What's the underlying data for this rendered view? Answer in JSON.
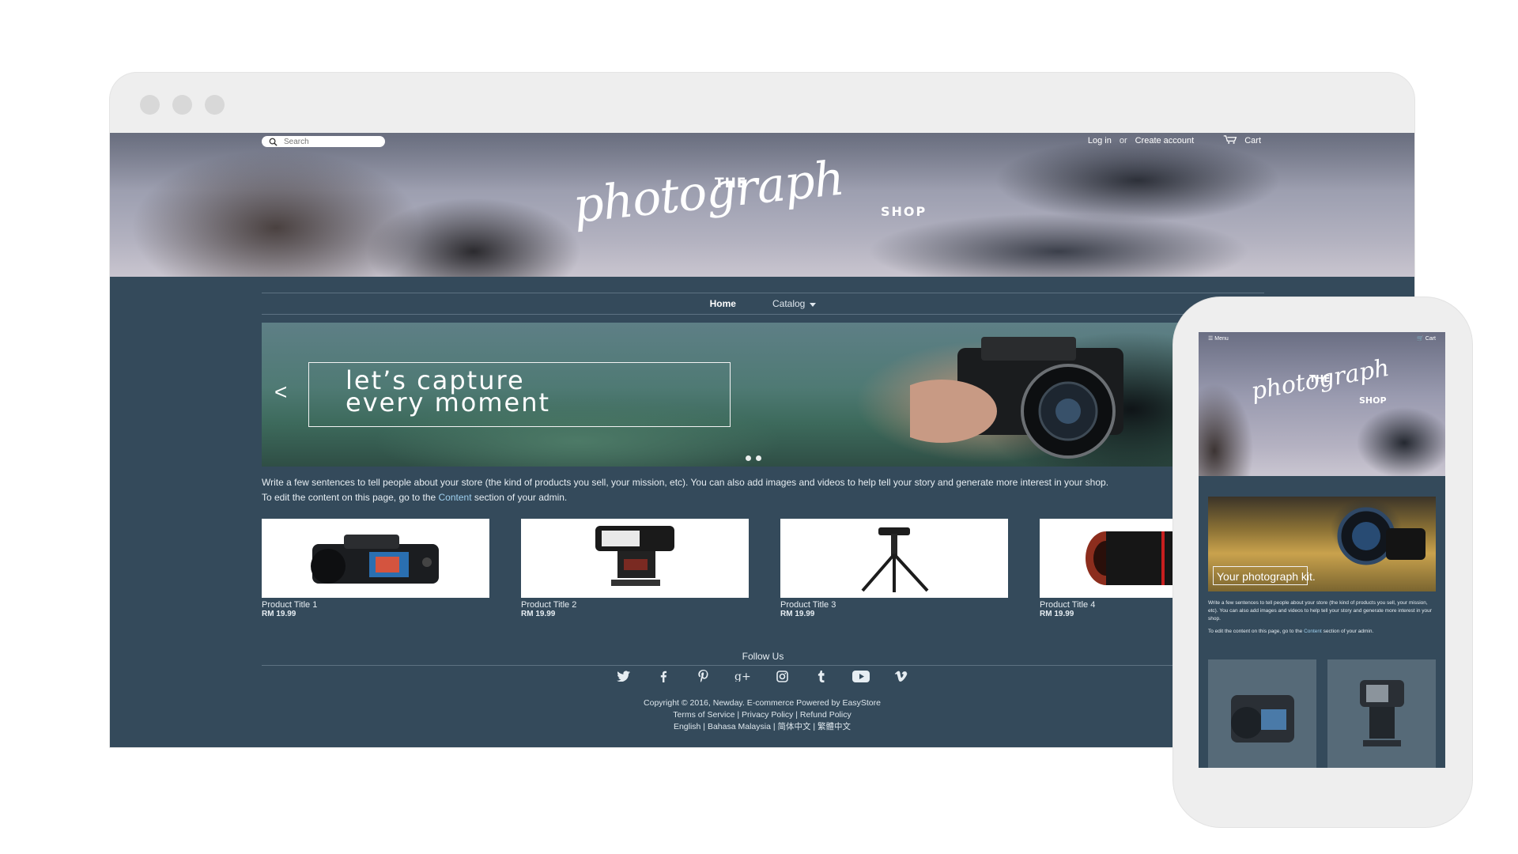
{
  "desktop": {
    "header": {
      "search_placeholder": "Search",
      "login_label": "Log in",
      "or_label": "or",
      "create_account_label": "Create account",
      "cart_label": "Cart",
      "logo": {
        "top": "THE",
        "script": "photograph",
        "bottom": "SHOP"
      }
    },
    "nav": {
      "home": "Home",
      "catalog": "Catalog"
    },
    "slideshow": {
      "line1": "let’s capture",
      "line2": "every moment",
      "prev_arrow": "<",
      "total_slides": 2
    },
    "intro": {
      "p1": "Write a few sentences to tell people about your store (the kind of products you sell, your mission, etc). You can also add images and videos to help tell your story and generate more interest in your shop.",
      "p2_prefix": "To edit the content on this page, go to the ",
      "p2_link": "Content",
      "p2_suffix": " section of your admin."
    },
    "products": [
      {
        "title": "Product Title 1",
        "price": "RM 19.99",
        "icon": "dslr-camera"
      },
      {
        "title": "Product Title 2",
        "price": "RM 19.99",
        "icon": "camera-flash"
      },
      {
        "title": "Product Title 3",
        "price": "RM 19.99",
        "icon": "tripod"
      },
      {
        "title": "Product Title 4",
        "price": "RM 19.99",
        "icon": "camera-lens"
      }
    ],
    "footer": {
      "follow_us": "Follow Us",
      "social_icons": [
        "twitter-icon",
        "facebook-icon",
        "pinterest-icon",
        "google-plus-icon",
        "instagram-icon",
        "tumblr-icon",
        "youtube-icon",
        "vimeo-icon"
      ],
      "copyright": "Copyright © 2016, Newday. E-commerce Powered by EasyStore",
      "policies": "Terms of Service | Privacy Policy | Refund Policy",
      "languages": "English | Bahasa Malaysia | 简体中文 | 繁體中文"
    }
  },
  "mobile": {
    "menu_label": "Menu",
    "cart_label": "Cart",
    "logo": {
      "top": "THE",
      "script": "photograph",
      "bottom": "SHOP"
    },
    "slide_caption": "Your photograph kit.",
    "intro_p1": "Write a few sentences to tell people about your store (the kind of products you sell, your mission, etc). You can also add images and videos to help tell your story and generate more interest in your shop.",
    "intro_p2_prefix": "To edit the content on this page, go to the ",
    "intro_p2_link": "Content",
    "intro_p2_suffix": " section of your admin."
  },
  "colors": {
    "page_bg": "#344a5b",
    "frame": "#eeeeee",
    "link": "#9fd0ef",
    "text": "#e6edf2"
  }
}
